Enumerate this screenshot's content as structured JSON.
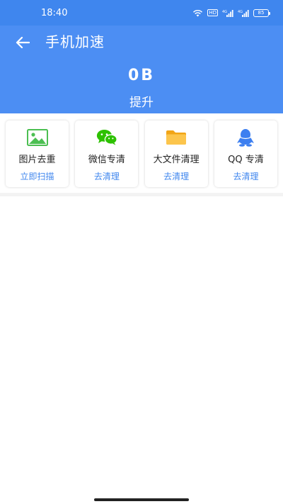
{
  "status_bar": {
    "time": "18:40",
    "hd_label": "HD",
    "signal_label_1": "4G",
    "signal_label_2": "4G",
    "battery_level": "85"
  },
  "header": {
    "back_icon": "arrow-left-icon",
    "title": "手机加速",
    "size_value": "0B",
    "size_caption": "提升"
  },
  "cards": [
    {
      "icon": "image-icon",
      "label": "图片去重",
      "action": "立即扫描"
    },
    {
      "icon": "wechat-icon",
      "label": "微信专清",
      "action": "去清理"
    },
    {
      "icon": "folder-icon",
      "label": "大文件清理",
      "action": "去清理"
    },
    {
      "icon": "qq-icon",
      "label": "QQ 专清",
      "action": "去清理"
    }
  ],
  "colors": {
    "header_bg": "#4c8ef3",
    "status_bg": "#3f86ee",
    "action_text": "#3f86ee",
    "image_icon": "#4cbf52",
    "wechat_icon": "#2dc100",
    "folder_icon": "#f8b938",
    "qq_icon": "#3d7ff0"
  }
}
